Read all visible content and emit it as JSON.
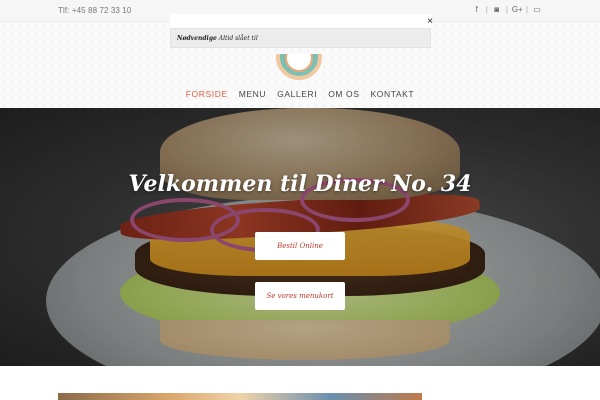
{
  "topbar": {
    "phone": "Tlf: +45 88 72 33 10",
    "social": [
      {
        "icon": "facebook-icon",
        "glyph": "f"
      },
      {
        "icon": "instagram-icon",
        "glyph": "◙"
      },
      {
        "icon": "google-plus-icon",
        "glyph": "G+"
      },
      {
        "icon": "book-icon",
        "glyph": "▭"
      }
    ],
    "separator": "|"
  },
  "popup": {
    "text_bold": "Nødvendige",
    "text_rest": "Altid slået til",
    "close": "×"
  },
  "nav": {
    "items": [
      {
        "label": "FORSIDE",
        "active": true
      },
      {
        "label": "MENU",
        "active": false
      },
      {
        "label": "GALLERI",
        "active": false
      },
      {
        "label": "OM OS",
        "active": false
      },
      {
        "label": "KONTAKT",
        "active": false
      }
    ]
  },
  "hero": {
    "title": "Velkommen til Diner No. 34",
    "buttons": [
      {
        "label": "Bestil Online"
      },
      {
        "label": "Se vores menukort"
      }
    ]
  },
  "colors": {
    "accent": "#e05a3a",
    "button_text": "#c0392b"
  }
}
